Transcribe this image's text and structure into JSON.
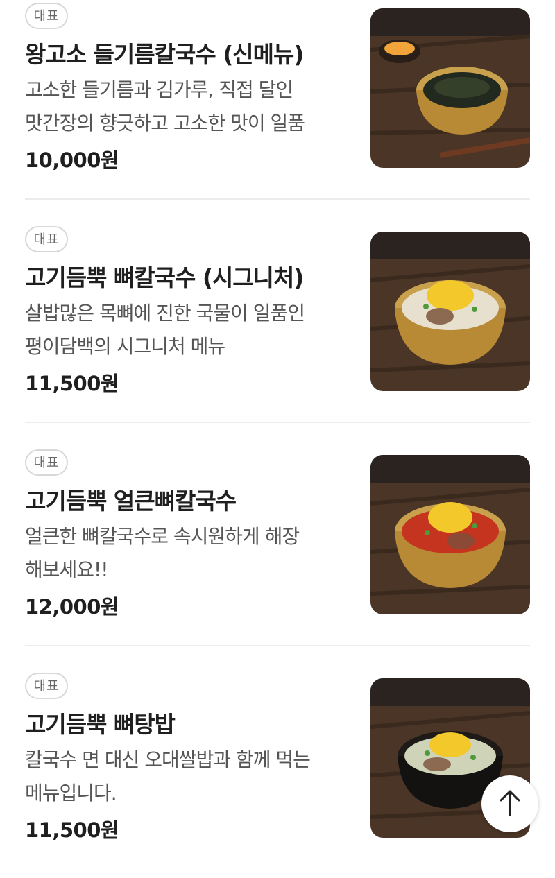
{
  "menu": [
    {
      "badge": "대표",
      "title": "왕고소 들기름칼국수 (신메뉴)",
      "desc_lines": [
        "고소한 들기름과 김가루, 직접 달인",
        "맛간장의 향긋하고 고소한 맛이 일품"
      ],
      "price": "10,000원",
      "image": "perilla-oil-noodle-photo"
    },
    {
      "badge": "대표",
      "title": "고기듬뿍 뼈칼국수 (시그니처)",
      "desc_lines": [
        "살밥많은 목뼈에 진한 국물이 일품인",
        "평이담백의 시그니처 메뉴"
      ],
      "price": "11,500원",
      "image": "pork-bone-noodle-photo"
    },
    {
      "badge": "대표",
      "title": "고기듬뿍 얼큰뼈칼국수",
      "desc_lines": [
        "얼큰한 뼈칼국수로 속시원하게 해장",
        "해보세요!!"
      ],
      "price": "12,000원",
      "image": "spicy-bone-noodle-photo"
    },
    {
      "badge": "대표",
      "title": "고기듬뿍 뼈탕밥",
      "desc_lines": [
        "칼국수 면 대신 오대쌀밥과 함께 먹는",
        "메뉴입니다."
      ],
      "price": "11,500원",
      "image": "bone-soup-rice-photo"
    }
  ],
  "scroll_top": {
    "icon": "arrow-up-icon"
  },
  "colors": {
    "divider": "#ececec",
    "badge_border": "#d8d8d8",
    "text": "#1f1f1f",
    "desc": "#555555"
  }
}
